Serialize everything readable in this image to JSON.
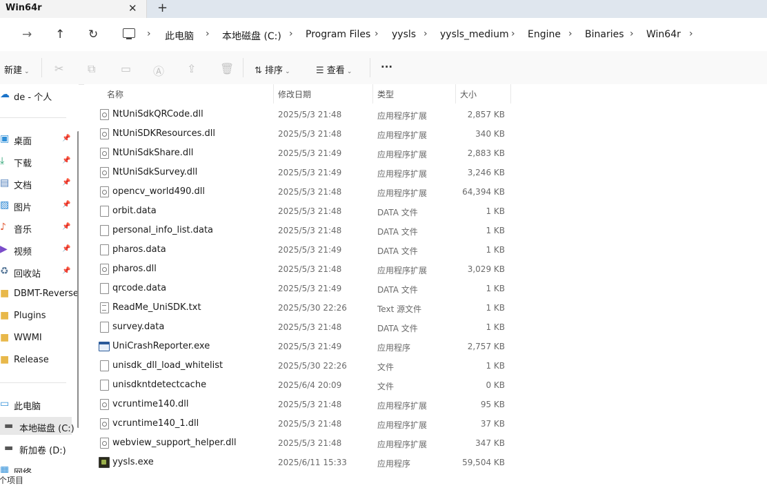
{
  "window": {
    "tab_title": "Win64r",
    "close_glyph": "✕",
    "new_tab_glyph": "+"
  },
  "breadcrumb": [
    "此电脑",
    "本地磁盘 (C:)",
    "Program Files",
    "yysls",
    "yysls_medium",
    "Engine",
    "Binaries",
    "Win64r"
  ],
  "toolbar": {
    "new_label": "新建",
    "sort_label": "排序",
    "view_label": "查看",
    "more_label": "···"
  },
  "sidebar": {
    "items": [
      {
        "label": "de - 个人",
        "icon": "cloud-icon"
      },
      {
        "label": "桌面",
        "icon": "desktop-icon",
        "pinned": true
      },
      {
        "label": "下载",
        "icon": "download-icon",
        "pinned": true
      },
      {
        "label": "文档",
        "icon": "documents-icon",
        "pinned": true
      },
      {
        "label": "图片",
        "icon": "pictures-icon",
        "pinned": true
      },
      {
        "label": "音乐",
        "icon": "music-icon",
        "pinned": true
      },
      {
        "label": "视频",
        "icon": "videos-icon",
        "pinned": true
      },
      {
        "label": "回收站",
        "icon": "recycle-bin-icon",
        "pinned": true
      },
      {
        "label": "DBMT-Reverse",
        "icon": "folder-icon"
      },
      {
        "label": "Plugins",
        "icon": "folder-icon"
      },
      {
        "label": "WWMI",
        "icon": "folder-icon"
      },
      {
        "label": "Release",
        "icon": "folder-icon"
      },
      {
        "label": "此电脑",
        "icon": "this-pc-icon"
      },
      {
        "label": "本地磁盘 (C:)",
        "icon": "drive-icon",
        "selected": true
      },
      {
        "label": "新加卷 (D:)",
        "icon": "drive-icon"
      },
      {
        "label": "网络",
        "icon": "network-icon"
      }
    ]
  },
  "columns": {
    "name": "名称",
    "date": "修改日期",
    "type": "类型",
    "size": "大小"
  },
  "files": [
    {
      "name": "NtUniSdkQRCode.dll",
      "date": "2025/5/3 21:48",
      "type": "应用程序扩展",
      "size": "2,857 KB",
      "icon": "dll"
    },
    {
      "name": "NtUniSDKResources.dll",
      "date": "2025/5/3 21:48",
      "type": "应用程序扩展",
      "size": "340 KB",
      "icon": "dll"
    },
    {
      "name": "NtUniSdkShare.dll",
      "date": "2025/5/3 21:49",
      "type": "应用程序扩展",
      "size": "2,883 KB",
      "icon": "dll"
    },
    {
      "name": "NtUniSdkSurvey.dll",
      "date": "2025/5/3 21:49",
      "type": "应用程序扩展",
      "size": "3,246 KB",
      "icon": "dll"
    },
    {
      "name": "opencv_world490.dll",
      "date": "2025/5/3 21:48",
      "type": "应用程序扩展",
      "size": "64,394 KB",
      "icon": "dll"
    },
    {
      "name": "orbit.data",
      "date": "2025/5/3 21:48",
      "type": "DATA 文件",
      "size": "1 KB",
      "icon": "file"
    },
    {
      "name": "personal_info_list.data",
      "date": "2025/5/3 21:48",
      "type": "DATA 文件",
      "size": "1 KB",
      "icon": "file"
    },
    {
      "name": "pharos.data",
      "date": "2025/5/3 21:49",
      "type": "DATA 文件",
      "size": "1 KB",
      "icon": "file"
    },
    {
      "name": "pharos.dll",
      "date": "2025/5/3 21:48",
      "type": "应用程序扩展",
      "size": "3,029 KB",
      "icon": "dll"
    },
    {
      "name": "qrcode.data",
      "date": "2025/5/3 21:49",
      "type": "DATA 文件",
      "size": "1 KB",
      "icon": "file"
    },
    {
      "name": "ReadMe_UniSDK.txt",
      "date": "2025/5/30 22:26",
      "type": "Text 源文件",
      "size": "1 KB",
      "icon": "txt"
    },
    {
      "name": "survey.data",
      "date": "2025/5/3 21:48",
      "type": "DATA 文件",
      "size": "1 KB",
      "icon": "file"
    },
    {
      "name": "UniCrashReporter.exe",
      "date": "2025/5/3 21:49",
      "type": "应用程序",
      "size": "2,757 KB",
      "icon": "exe"
    },
    {
      "name": "unisdk_dll_load_whitelist",
      "date": "2025/5/30 22:26",
      "type": "文件",
      "size": "1 KB",
      "icon": "file"
    },
    {
      "name": "unisdkntdetectcache",
      "date": "2025/6/4 20:09",
      "type": "文件",
      "size": "0 KB",
      "icon": "file"
    },
    {
      "name": "vcruntime140.dll",
      "date": "2025/5/3 21:48",
      "type": "应用程序扩展",
      "size": "95 KB",
      "icon": "dll"
    },
    {
      "name": "vcruntime140_1.dll",
      "date": "2025/5/3 21:48",
      "type": "应用程序扩展",
      "size": "37 KB",
      "icon": "dll"
    },
    {
      "name": "webview_support_helper.dll",
      "date": "2025/5/3 21:48",
      "type": "应用程序扩展",
      "size": "347 KB",
      "icon": "dll"
    },
    {
      "name": "yysls.exe",
      "date": "2025/6/11 15:33",
      "type": "应用程序",
      "size": "59,504 KB",
      "icon": "game"
    }
  ],
  "status": {
    "text": "个项目"
  }
}
